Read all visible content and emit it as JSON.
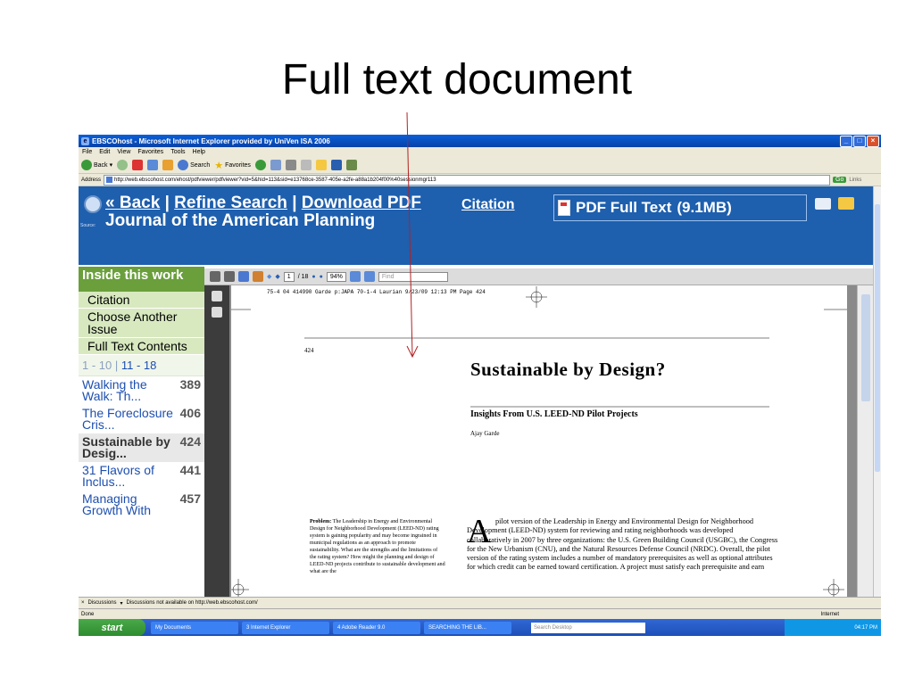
{
  "slide": {
    "title": "Full text document"
  },
  "window": {
    "title": "EBSCOhost - Microsoft Internet Explorer provided by UniVen ISA 2006",
    "menu": [
      "File",
      "Edit",
      "View",
      "Favorites",
      "Tools",
      "Help"
    ],
    "toolbar": {
      "back": "Back",
      "search": "Search",
      "favorites": "Favorites"
    },
    "address_label": "Address",
    "address": "http://web.ebscohost.com/ehost/pdfviewer/pdfviewer?vid=5&hid=113&sid=e13768ce-3587-405e-a2fe-a88a1b204f00%40sessionmgr113",
    "go": "Go",
    "links": "Links"
  },
  "banner": {
    "back": "« Back",
    "sep1": "|",
    "refine": "Refine Search",
    "sep2": "|",
    "download": "Download PDF",
    "source_label": "Source:",
    "journal": "Journal of the American Planning",
    "citation": "Citation",
    "pdf_full_text": "PDF Full Text",
    "pdf_size": "(9.1MB)"
  },
  "sidebar": {
    "heading": "Inside this work",
    "items": [
      "Citation",
      "Choose Another Issue",
      "Full Text Contents"
    ],
    "pager": {
      "prev": "1 - 10",
      "current": "11 - 18"
    },
    "articles": [
      {
        "title": "Walking the Walk: Th...",
        "page": "389"
      },
      {
        "title": "The Foreclosure Cris...",
        "page": "406"
      },
      {
        "title": "Sustainable by Desig...",
        "page": "424"
      },
      {
        "title": "31 Flavors of Inclus...",
        "page": "441"
      },
      {
        "title": "Managing Growth With",
        "page": "457"
      }
    ]
  },
  "pdf": {
    "page_current": "1",
    "page_total": "/ 18",
    "zoom": "94%",
    "find_placeholder": "Find",
    "header_line": "75-4 04 414990 Garde p:JAPA 70-1-4 Laurian  9/23/09  12:13 PM  Page 424",
    "page_number": "424",
    "title": "Sustainable by Design?",
    "subtitle": "Insights From U.S. LEED-ND Pilot Projects",
    "author": "Ajay Garde",
    "problem_label": "Problem:",
    "problem_text": " The Leadership in Energy and Environmental Design for Neighborhood Development (LEED-ND) rating system is gaining popularity and may become ingrained in municipal regulations as an approach to promote sustainability. What are the strengths and the limitations of the rating system? How might the planning and design of LEED-ND projects contribute to sustainable development and what are the",
    "dropcap": "A",
    "body": "pilot version of the Leadership in Energy and Environmental Design for Neighborhood Development (LEED-ND) system for reviewing and rating neighborhoods was developed collaboratively in 2007 by three organizations: the U.S. Green Building Council (USGBC), the Congress for the New Urbanism (CNU), and the Natural Resources Defense Council (NRDC). Overall, the pilot version of the rating system includes a number of mandatory prerequisites as well as optional attributes for which credit can be earned toward certification. A project must satisfy each prerequisite and earn"
  },
  "status": {
    "discussions": "Discussions",
    "discussions_note": "Discussions not available on http://web.ebscohost.com/",
    "done": "Done",
    "zone": "Internet"
  },
  "taskbar": {
    "start": "start",
    "tasks": [
      "My Documents",
      "3 Internet Explorer",
      "4 Adobe Reader 9.0",
      "SEARCHING THE LIB..."
    ],
    "search_placeholder": "Search Desktop",
    "time": "04:17 PM"
  },
  "colors": {
    "banner": "#1e5fae",
    "sidebar_green": "#6a9f3c",
    "arrow": "#b22222"
  }
}
